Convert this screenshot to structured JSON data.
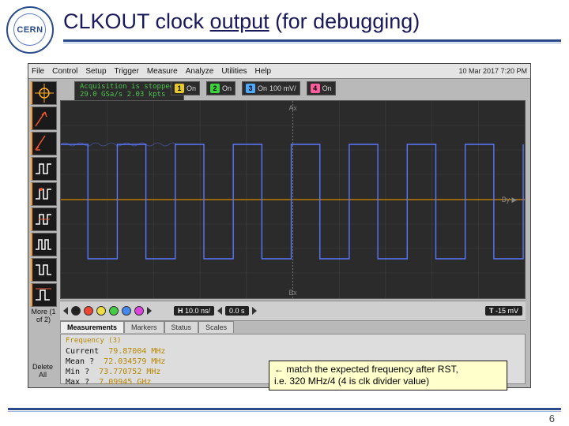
{
  "slide": {
    "title_prefix": "CLKOUT clock ",
    "title_underlined": "output",
    "title_suffix": " (for debugging)",
    "page_number": "6"
  },
  "scope": {
    "menu": [
      "File",
      "Control",
      "Setup",
      "Trigger",
      "Measure",
      "Analyze",
      "Utilities",
      "Help"
    ],
    "timestamp": "10 Mar 2017  7:20 PM",
    "acquisition_line1": "Acquisition is stopped.",
    "acquisition_line2": "29.0 GSa/s   2.03 kpts",
    "channels": [
      {
        "n": "1",
        "class": "c1",
        "state": "On",
        "scale": ""
      },
      {
        "n": "2",
        "class": "c2",
        "state": "On",
        "scale": ""
      },
      {
        "n": "3",
        "class": "c3",
        "state": "On",
        "scale": "100 mV/"
      },
      {
        "n": "4",
        "class": "c4",
        "state": "On",
        "scale": ""
      }
    ],
    "toolbar_icons": [
      "cursor-icon",
      "zoom-xy-icon",
      "zoom-down-icon",
      "square-wave-icon",
      "square-wave-2-icon",
      "square-wave-3-icon",
      "square-wave-4-icon",
      "square-wave-5-icon",
      "square-wave-6-icon"
    ],
    "more_label": "More\n(1 of 2)",
    "delete_all": "Delete\nAll",
    "timebase": {
      "H": "10.0 ns/",
      "pos": "0.0 s",
      "T": "-15 mV"
    },
    "tabs": [
      "Measurements",
      "Markers",
      "Status",
      "Scales"
    ],
    "active_tab": 0,
    "measurement": {
      "header": "Frequency (3)",
      "rows": [
        [
          "Current",
          "79.87004 MHz"
        ],
        [
          "Mean ?",
          "72.034579 MHz"
        ],
        [
          "Min ?",
          "73.770752 MHz"
        ],
        [
          "Max ?",
          "7.09945 GHz"
        ]
      ]
    }
  },
  "annotation": {
    "arrow": "←",
    "line1": " match the expected frequency after RST,",
    "line2": "i.e. 320 MHz/4 (4 is clk divider value)"
  }
}
